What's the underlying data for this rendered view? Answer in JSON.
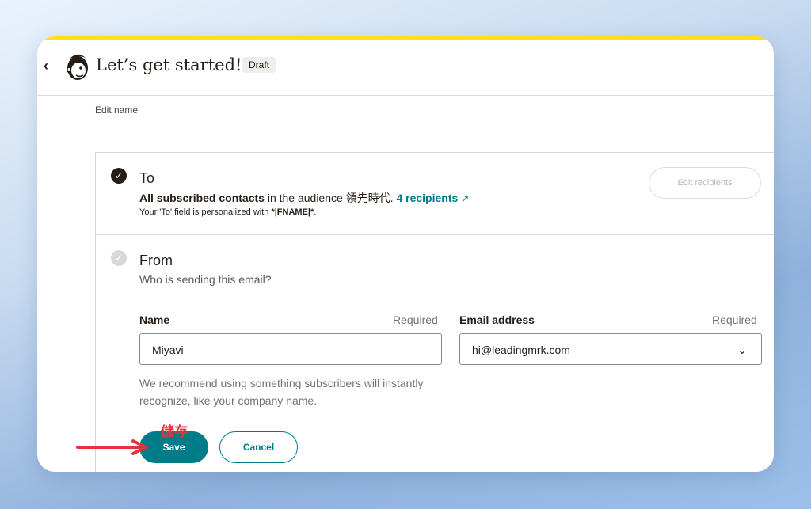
{
  "header": {
    "title": "Let’s get started!",
    "badge": "Draft",
    "back_icon": "chevron-left-icon",
    "logo_icon": "mailchimp-freddie-icon"
  },
  "edit_name_link": "Edit name",
  "to_section": {
    "title": "To",
    "audience_bold": "All subscribed contacts",
    "audience_mid": " in the audience 領先時代. ",
    "recipients_link": "4 recipients",
    "personalized_prefix": "Your 'To' field is personalized with ",
    "personalized_tag": "*|FNAME|*",
    "personalized_suffix": ".",
    "edit_recipients_button": "Edit recipients"
  },
  "from_section": {
    "title": "From",
    "subtitle": "Who is sending this email?",
    "name_label": "Name",
    "name_required": "Required",
    "name_value": "Miyavi",
    "email_label": "Email address",
    "email_required": "Required",
    "email_value": "hi@leadingmrk.com",
    "help_text": "We recommend using something subscribers will instantly recognize, like your company name.",
    "save_button": "Save",
    "cancel_button": "Cancel"
  },
  "annotation": {
    "label": "儲存",
    "color": "#e8323a"
  },
  "colors": {
    "accent": "#007c89",
    "stripe": "#ffe01b",
    "text": "#241c15"
  }
}
